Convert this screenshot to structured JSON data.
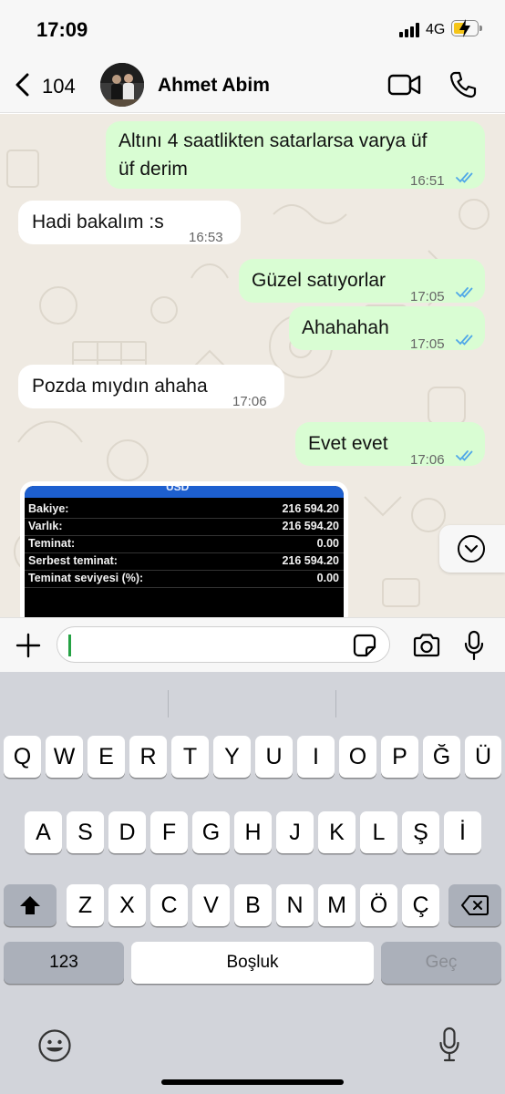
{
  "status_bar": {
    "time": "17:09",
    "network": "4G"
  },
  "header": {
    "back_count": "104",
    "contact_name": "Ahmet Abim"
  },
  "messages": [
    {
      "direction": "out",
      "text_line1": "Altını 4 saatlikten satarlarsa varya üf",
      "text_line2": "üf derim",
      "time": "16:51",
      "read": true
    },
    {
      "direction": "in",
      "text": "Hadi bakalım :s",
      "time": "16:53"
    },
    {
      "direction": "out",
      "text": "Güzel satıyorlar",
      "time": "17:05",
      "read": true
    },
    {
      "direction": "out",
      "text": "Ahahahah",
      "time": "17:05",
      "read": true
    },
    {
      "direction": "in",
      "text": "Pozda mıydın ahaha",
      "time": "17:06"
    },
    {
      "direction": "out",
      "text": "Evet evet",
      "time": "17:06",
      "read": true
    }
  ],
  "image_message": {
    "header_text": "USD",
    "rows": [
      {
        "label": "Bakiye:",
        "value": "216 594.20"
      },
      {
        "label": "Varlık:",
        "value": "216 594.20"
      },
      {
        "label": "Teminat:",
        "value": "0.00"
      },
      {
        "label": "Serbest teminat:",
        "value": "216 594.20"
      },
      {
        "label": "Teminat seviyesi (%):",
        "value": "0.00"
      }
    ]
  },
  "input": {
    "value": ""
  },
  "keyboard": {
    "row1": [
      "Q",
      "W",
      "E",
      "R",
      "T",
      "Y",
      "U",
      "I",
      "O",
      "P",
      "Ğ",
      "Ü"
    ],
    "row2": [
      "A",
      "S",
      "D",
      "F",
      "G",
      "H",
      "J",
      "K",
      "L",
      "Ş",
      "İ"
    ],
    "row3": [
      "Z",
      "X",
      "C",
      "V",
      "B",
      "N",
      "M",
      "Ö",
      "Ç"
    ],
    "numbers_key": "123",
    "space_key": "Boşluk",
    "return_key": "Geç"
  },
  "colors": {
    "outgoing_bubble": "#d9fdd3",
    "incoming_bubble": "#ffffff",
    "read_ticks": "#4fa7e8",
    "chat_background": "#efeae2",
    "keyboard_background": "#d2d4da"
  },
  "icons": [
    "back-chevron-icon",
    "video-call-icon",
    "phone-icon",
    "plus-icon",
    "sticker-icon",
    "camera-icon",
    "mic-icon",
    "chevron-down-icon",
    "emoji-icon",
    "shift-icon",
    "backspace-icon"
  ]
}
